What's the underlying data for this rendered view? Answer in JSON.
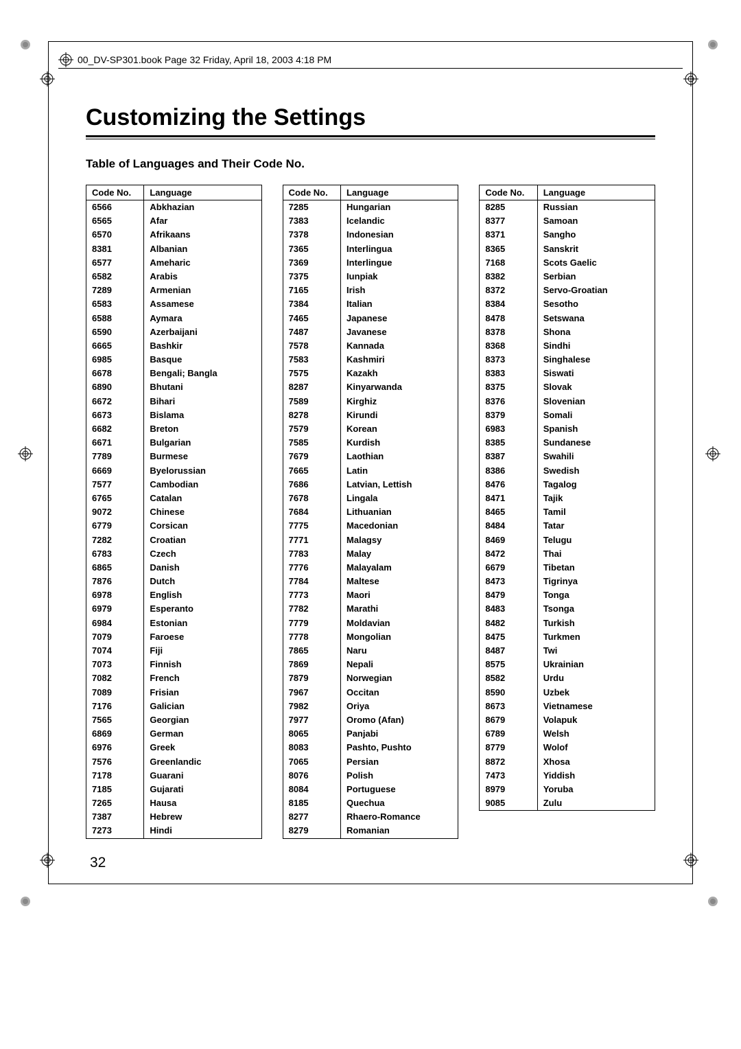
{
  "meta": "00_DV-SP301.book  Page 32  Friday, April 18, 2003  4:18 PM",
  "title": "Customizing the Settings",
  "subtitle": "Table of Languages and Their Code No.",
  "headers": {
    "code": "Code No.",
    "lang": "Language"
  },
  "page": "32",
  "columns": [
    [
      [
        "6566",
        "Abkhazian"
      ],
      [
        "6565",
        "Afar"
      ],
      [
        "6570",
        "Afrikaans"
      ],
      [
        "8381",
        "Albanian"
      ],
      [
        "6577",
        "Ameharic"
      ],
      [
        "6582",
        "Arabis"
      ],
      [
        "7289",
        "Armenian"
      ],
      [
        "6583",
        "Assamese"
      ],
      [
        "6588",
        "Aymara"
      ],
      [
        "6590",
        "Azerbaijani"
      ],
      [
        "6665",
        "Bashkir"
      ],
      [
        "6985",
        "Basque"
      ],
      [
        "6678",
        "Bengali; Bangla"
      ],
      [
        "6890",
        "Bhutani"
      ],
      [
        "6672",
        "Bihari"
      ],
      [
        "6673",
        "Bislama"
      ],
      [
        "6682",
        "Breton"
      ],
      [
        "6671",
        "Bulgarian"
      ],
      [
        "7789",
        "Burmese"
      ],
      [
        "6669",
        "Byelorussian"
      ],
      [
        "7577",
        "Cambodian"
      ],
      [
        "6765",
        "Catalan"
      ],
      [
        "9072",
        "Chinese"
      ],
      [
        "6779",
        "Corsican"
      ],
      [
        "7282",
        "Croatian"
      ],
      [
        "6783",
        "Czech"
      ],
      [
        "6865",
        "Danish"
      ],
      [
        "7876",
        "Dutch"
      ],
      [
        "6978",
        "English"
      ],
      [
        "6979",
        "Esperanto"
      ],
      [
        "6984",
        "Estonian"
      ],
      [
        "7079",
        "Faroese"
      ],
      [
        "7074",
        "Fiji"
      ],
      [
        "7073",
        "Finnish"
      ],
      [
        "7082",
        "French"
      ],
      [
        "7089",
        "Frisian"
      ],
      [
        "7176",
        "Galician"
      ],
      [
        "7565",
        "Georgian"
      ],
      [
        "6869",
        "German"
      ],
      [
        "6976",
        "Greek"
      ],
      [
        "7576",
        "Greenlandic"
      ],
      [
        "7178",
        "Guarani"
      ],
      [
        "7185",
        "Gujarati"
      ],
      [
        "7265",
        "Hausa"
      ],
      [
        "7387",
        "Hebrew"
      ],
      [
        "7273",
        "Hindi"
      ]
    ],
    [
      [
        "7285",
        "Hungarian"
      ],
      [
        "7383",
        "Icelandic"
      ],
      [
        "7378",
        "Indonesian"
      ],
      [
        "7365",
        "Interlingua"
      ],
      [
        "7369",
        "Interlingue"
      ],
      [
        "7375",
        "Iunpiak"
      ],
      [
        "7165",
        "Irish"
      ],
      [
        "7384",
        "Italian"
      ],
      [
        "7465",
        "Japanese"
      ],
      [
        "7487",
        "Javanese"
      ],
      [
        "7578",
        "Kannada"
      ],
      [
        "7583",
        "Kashmiri"
      ],
      [
        "7575",
        "Kazakh"
      ],
      [
        "8287",
        "Kinyarwanda"
      ],
      [
        "7589",
        "Kirghiz"
      ],
      [
        "8278",
        "Kirundi"
      ],
      [
        "7579",
        "Korean"
      ],
      [
        "7585",
        "Kurdish"
      ],
      [
        "7679",
        "Laothian"
      ],
      [
        "7665",
        "Latin"
      ],
      [
        "7686",
        "Latvian, Lettish"
      ],
      [
        "7678",
        "Lingala"
      ],
      [
        "7684",
        "Lithuanian"
      ],
      [
        "7775",
        "Macedonian"
      ],
      [
        "7771",
        "Malagsy"
      ],
      [
        "7783",
        "Malay"
      ],
      [
        "7776",
        "Malayalam"
      ],
      [
        "7784",
        "Maltese"
      ],
      [
        "7773",
        "Maori"
      ],
      [
        "7782",
        "Marathi"
      ],
      [
        "7779",
        "Moldavian"
      ],
      [
        "7778",
        "Mongolian"
      ],
      [
        "7865",
        "Naru"
      ],
      [
        "7869",
        "Nepali"
      ],
      [
        "7879",
        "Norwegian"
      ],
      [
        "7967",
        "Occitan"
      ],
      [
        "7982",
        "Oriya"
      ],
      [
        "7977",
        "Oromo (Afan)"
      ],
      [
        "8065",
        "Panjabi"
      ],
      [
        "8083",
        "Pashto, Pushto"
      ],
      [
        "7065",
        "Persian"
      ],
      [
        "8076",
        "Polish"
      ],
      [
        "8084",
        "Portuguese"
      ],
      [
        "8185",
        "Quechua"
      ],
      [
        "8277",
        "Rhaero-Romance"
      ],
      [
        "8279",
        "Romanian"
      ]
    ],
    [
      [
        "8285",
        "Russian"
      ],
      [
        "8377",
        "Samoan"
      ],
      [
        "8371",
        "Sangho"
      ],
      [
        "8365",
        "Sanskrit"
      ],
      [
        "7168",
        "Scots Gaelic"
      ],
      [
        "8382",
        "Serbian"
      ],
      [
        "8372",
        "Servo-Groatian"
      ],
      [
        "8384",
        "Sesotho"
      ],
      [
        "8478",
        "Setswana"
      ],
      [
        "8378",
        "Shona"
      ],
      [
        "8368",
        "Sindhi"
      ],
      [
        "8373",
        "Singhalese"
      ],
      [
        "8383",
        "Siswati"
      ],
      [
        "8375",
        "Slovak"
      ],
      [
        "8376",
        "Slovenian"
      ],
      [
        "8379",
        "Somali"
      ],
      [
        "6983",
        "Spanish"
      ],
      [
        "8385",
        "Sundanese"
      ],
      [
        "8387",
        "Swahili"
      ],
      [
        "8386",
        "Swedish"
      ],
      [
        "8476",
        "Tagalog"
      ],
      [
        "8471",
        "Tajik"
      ],
      [
        "8465",
        "Tamil"
      ],
      [
        "8484",
        "Tatar"
      ],
      [
        "8469",
        "Telugu"
      ],
      [
        "8472",
        "Thai"
      ],
      [
        "6679",
        "Tibetan"
      ],
      [
        "8473",
        "Tigrinya"
      ],
      [
        "8479",
        "Tonga"
      ],
      [
        "8483",
        "Tsonga"
      ],
      [
        "8482",
        "Turkish"
      ],
      [
        "8475",
        "Turkmen"
      ],
      [
        "8487",
        "Twi"
      ],
      [
        "8575",
        "Ukrainian"
      ],
      [
        "8582",
        "Urdu"
      ],
      [
        "8590",
        "Uzbek"
      ],
      [
        "8673",
        "Vietnamese"
      ],
      [
        "8679",
        "Volapuk"
      ],
      [
        "6789",
        "Welsh"
      ],
      [
        "8779",
        "Wolof"
      ],
      [
        "8872",
        "Xhosa"
      ],
      [
        "7473",
        "Yiddish"
      ],
      [
        "8979",
        "Yoruba"
      ],
      [
        "9085",
        "Zulu"
      ]
    ]
  ]
}
